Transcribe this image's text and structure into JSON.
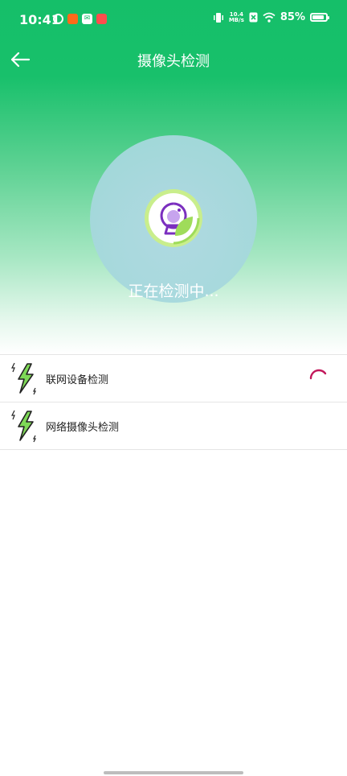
{
  "status_bar": {
    "time": "10:41",
    "speed_value": "10.4",
    "speed_unit": "MB/s",
    "battery": "85%",
    "battery_level": 0.85
  },
  "header": {
    "title": "摄像头检测",
    "back_icon": "arrow-left-icon"
  },
  "scan": {
    "status_text": "正在检测中...",
    "icon": "webcam-icon"
  },
  "checks": [
    {
      "label": "联网设备检测",
      "icon": "lightning-icon",
      "state": "loading"
    },
    {
      "label": "网络摄像头检测",
      "icon": "lightning-icon",
      "state": "pending"
    }
  ],
  "colors": {
    "primary": "#18c06b",
    "spinner": "#c2185b",
    "lightning": "#7ed957",
    "camera_purple": "#7b2fbf"
  }
}
